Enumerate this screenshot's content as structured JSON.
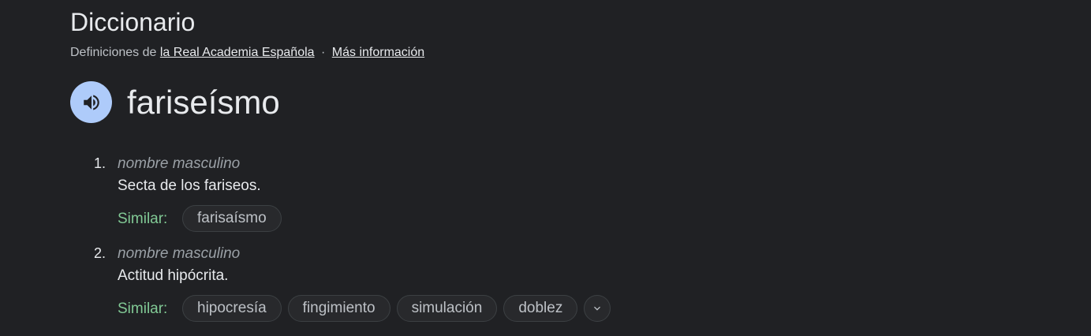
{
  "header": {
    "title": "Diccionario",
    "source_prefix": "Definiciones de",
    "source_link": "la Real Academia Española",
    "separator": "·",
    "more_info_link": "Más información"
  },
  "entry": {
    "word": "fariseísmo",
    "audio_icon": "speaker-icon"
  },
  "senses": [
    {
      "number": "1.",
      "part_of_speech": "nombre masculino",
      "definition": "Secta de los fariseos.",
      "similar_label": "Similar:",
      "similar": [
        "farisaísmo"
      ]
    },
    {
      "number": "2.",
      "part_of_speech": "nombre masculino",
      "definition": "Actitud hipócrita.",
      "similar_label": "Similar:",
      "similar": [
        "hipocresía",
        "fingimiento",
        "simulación",
        "doblez"
      ],
      "more_icon": "chevron-down-icon"
    }
  ],
  "colors": {
    "background": "#202124",
    "audio_button": "#aecbfa",
    "similar_label": "#81c995",
    "part_of_speech": "#9aa0a6"
  }
}
